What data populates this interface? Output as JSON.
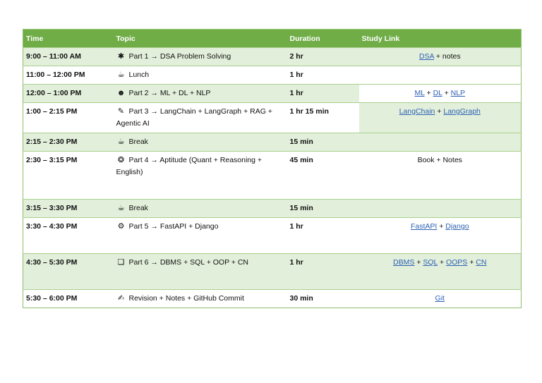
{
  "header": {
    "time": "Time",
    "topic": "Topic",
    "duration": "Duration",
    "study_link": "Study Link"
  },
  "rows": [
    {
      "time": "9:00 – 11:00 AM",
      "icon": "puzzle-icon",
      "icon_glyph": "✱",
      "topic": "Part 1 → DSA Problem Solving",
      "duration": "2 hr",
      "links": [
        {
          "text": "DSA",
          "type": "link"
        },
        {
          "text": " + notes",
          "type": "text"
        }
      ]
    },
    {
      "time": "11:00 – 12:00 PM",
      "icon": "lunch-icon",
      "icon_glyph": "☕",
      "topic": "Lunch",
      "duration": "1 hr",
      "links": []
    },
    {
      "time": "12:00 – 1:00 PM",
      "icon": "robot-icon",
      "icon_glyph": "☻",
      "topic": "Part 2 → ML + DL + NLP",
      "duration": "1 hr",
      "links": [
        {
          "text": "ML",
          "type": "link"
        },
        {
          "text": " + ",
          "type": "text"
        },
        {
          "text": "DL",
          "type": "link"
        },
        {
          "text": " + ",
          "type": "text"
        },
        {
          "text": "NLP",
          "type": "link"
        }
      ]
    },
    {
      "time": "1:00 – 2:15 PM",
      "icon": "link-icon",
      "icon_glyph": "✎",
      "topic": "Part 3 → LangChain + LangGraph + RAG + Agentic AI",
      "duration": "1 hr 15 min",
      "links": [
        {
          "text": "LangChain",
          "type": "link"
        },
        {
          "text": " + ",
          "type": "text"
        },
        {
          "text": "LangGraph",
          "type": "link"
        }
      ]
    },
    {
      "time": "2:15 – 2:30 PM",
      "icon": "coffee-icon",
      "icon_glyph": "☕",
      "topic": "Break",
      "duration": "15 min",
      "links": []
    },
    {
      "time": "2:30 – 3:15 PM",
      "icon": "brain-icon",
      "icon_glyph": "❂",
      "topic": "Part 4 → Aptitude (Quant + Reasoning + English)",
      "duration": "45 min",
      "links": [
        {
          "text": "Book + Notes",
          "type": "text"
        }
      ]
    },
    {
      "time": "3:15 – 3:30 PM",
      "icon": "coffee-icon",
      "icon_glyph": "☕",
      "topic": "Break",
      "duration": "15 min",
      "links": []
    },
    {
      "time": "3:30 – 4:30 PM",
      "icon": "gear-icon",
      "icon_glyph": "⚙",
      "topic": "Part 5 → FastAPI + Django",
      "duration": "1 hr",
      "links": [
        {
          "text": "FastAPI",
          "type": "link"
        },
        {
          "text": " + ",
          "type": "text"
        },
        {
          "text": "Django",
          "type": "link"
        }
      ]
    },
    {
      "time": "4:30 – 5:30 PM",
      "icon": "database-icon",
      "icon_glyph": "❏",
      "topic": "Part 6 → DBMS + SQL + OOP + CN",
      "duration": "1 hr",
      "links": [
        {
          "text": "DBMS",
          "type": "link"
        },
        {
          "text": " + ",
          "type": "text"
        },
        {
          "text": "SQL",
          "type": "link"
        },
        {
          "text": " + ",
          "type": "text"
        },
        {
          "text": "OOPS",
          "type": "link"
        },
        {
          "text": " + ",
          "type": "text"
        },
        {
          "text": "CN",
          "type": "link"
        }
      ]
    },
    {
      "time": "5:30 – 6:00 PM",
      "icon": "notes-icon",
      "icon_glyph": "✍",
      "topic": "Revision + Notes + GitHub Commit",
      "duration": "30 min",
      "links": [
        {
          "text": "Git",
          "type": "link"
        }
      ]
    }
  ],
  "colors": {
    "header_bg": "#70ad47",
    "row_shade": "#e2efda",
    "link": "#2e62b5"
  }
}
